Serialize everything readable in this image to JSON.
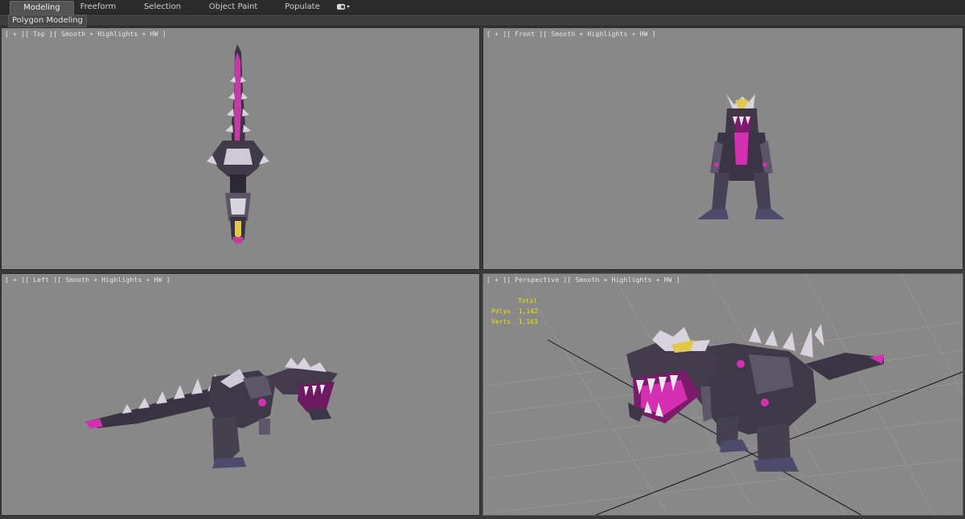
{
  "ribbon": {
    "tabs": [
      {
        "label": "Modeling",
        "active": true
      },
      {
        "label": "Freeform",
        "active": false
      },
      {
        "label": "Selection",
        "active": false
      },
      {
        "label": "Object Paint",
        "active": false
      },
      {
        "label": "Populate",
        "active": false
      }
    ],
    "extra_icon": "toggle-icon"
  },
  "subbar": {
    "label": "Polygon Modeling"
  },
  "viewports": {
    "top": {
      "label": "[ + ][ Top ][ Smooth + Highlights + HW ]"
    },
    "front": {
      "label": "[ + ][ Front ][ Smooth + Highlights + HW ]"
    },
    "left": {
      "label": "[ + ][ Left ][ Smooth + Highlights + HW ]"
    },
    "perspective": {
      "label": "[ + ][ Perspective ][ Smooth + Highlights + HW ]"
    }
  },
  "stats": {
    "header": "Total",
    "polys_label": "Polys",
    "polys_value": "1,142",
    "verts_label": "Verts",
    "verts_value": "1,163"
  },
  "colors": {
    "viewport_bg": "#888888",
    "accent_magenta": "#d42fb0",
    "stats_text": "#e9e300"
  }
}
